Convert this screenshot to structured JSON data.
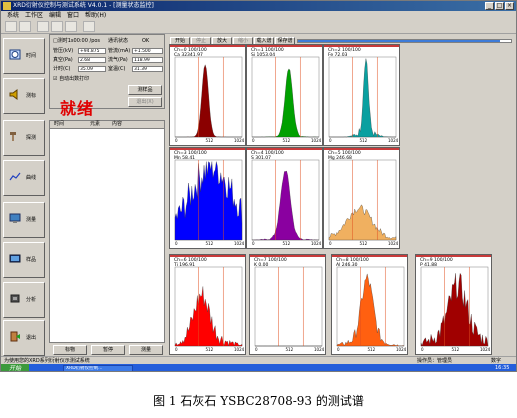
{
  "window": {
    "title": "XRD衍射仪控制与测试系统 V4.0.1 - [测量状态监控]"
  },
  "menu": [
    "系统",
    "工作区",
    "编辑",
    "窗口",
    "帮助(H)"
  ],
  "sidebar": {
    "items": [
      {
        "label": "时间",
        "icon": "clock-icon"
      },
      {
        "label": "测标",
        "icon": "speaker-icon"
      },
      {
        "label": "探测",
        "icon": "hammer-icon"
      },
      {
        "label": "曲线",
        "icon": "curve-icon"
      },
      {
        "label": "测量",
        "icon": "monitor-icon"
      },
      {
        "label": "样品",
        "icon": "screen-icon"
      },
      {
        "label": "分析",
        "icon": "chip-icon"
      },
      {
        "label": "退出",
        "icon": "exit-icon"
      }
    ]
  },
  "info": {
    "header_left": "□测时1s00:00 /pos",
    "header_right_label": "通讯状态",
    "header_right_value": "OK",
    "rows": [
      {
        "l1": "管压(kV)",
        "v1": "+94.875",
        "l2": "管流(mA)",
        "v2": "+1.500"
      },
      {
        "l1": "真空(Pa)",
        "v1": "2.68",
        "l2": "流气(Pa)",
        "v2": "118.99"
      },
      {
        "l1": "计时(C)",
        "v1": "35.09",
        "l2": "室温(C)",
        "v2": "31.39"
      }
    ],
    "checkbox_label": "☑ 自动出数打印",
    "status": "就绪",
    "btn_right_top": "测样品",
    "btn_right_bottom": "退出(X)"
  },
  "list": {
    "headers": [
      "时间",
      "元素",
      "内容"
    ]
  },
  "bottom_buttons": [
    "标物",
    "暂停",
    "测量"
  ],
  "statusbar": {
    "left": "为使用您的XRD系列衍射仪示测试系统",
    "user_label": "操作员：",
    "user_value": "管理员",
    "right": "数字"
  },
  "taskbar": {
    "start": "开始",
    "items": [
      "XRD衍射仪控制..."
    ],
    "clock": "16:35"
  },
  "charts_toolbar": {
    "buttons": [
      "开始",
      "停止",
      "放大",
      "缩小",
      "载入谱",
      "保存谱"
    ],
    "progress": 0.95
  },
  "panels": [
    {
      "line1": "Ch=0 100/100",
      "line2": "Ca 32341.97",
      "color": "#8b0000",
      "ticks": [
        "0",
        "512",
        "1024"
      ]
    },
    {
      "line1": "Ch=1 100/100",
      "line2": "Si 1053.04",
      "color": "#00a000",
      "ticks": [
        "0",
        "512",
        "1024"
      ]
    },
    {
      "line1": "Ch=2 100/100",
      "line2": "Fe 72.03",
      "color": "#0aa0a0",
      "ticks": [
        "0",
        "512",
        "1024"
      ]
    },
    {
      "line1": "Ch=3 100/100",
      "line2": "Mn 58.41",
      "color": "#0000ff",
      "ticks": [
        "0",
        "512",
        "1024"
      ]
    },
    {
      "line1": "Ch=4 100/100",
      "line2": "S 301.07",
      "color": "#8a00a0",
      "ticks": [
        "0",
        "512",
        "1024"
      ]
    },
    {
      "line1": "Ch=5 100/100",
      "line2": "Mg 246.68",
      "color": "#f0b060",
      "ticks": [
        "0",
        "512",
        "1024"
      ]
    },
    {
      "line1": "Ch=6 100/100",
      "line2": "Ti 196.91",
      "color": "#ff0000",
      "ticks": [
        "0",
        "512",
        "1024"
      ]
    },
    {
      "line1": "Ch=7 100/100",
      "line2": "K 0.00",
      "color": "#ff0000",
      "ticks": [
        "0",
        "512",
        "1024"
      ]
    },
    {
      "line1": "Ch=8 100/100",
      "line2": "Al 246.30",
      "color": "#ff6010",
      "ticks": [
        "0",
        "512",
        "1024"
      ]
    },
    {
      "line1": "Ch=9 100/100",
      "line2": "P 41.88",
      "color": "#a00000",
      "ticks": [
        "0",
        "512",
        "1024"
      ]
    }
  ],
  "caption": "图 1   石灰石 YSBC28708-93 的测试谱"
}
